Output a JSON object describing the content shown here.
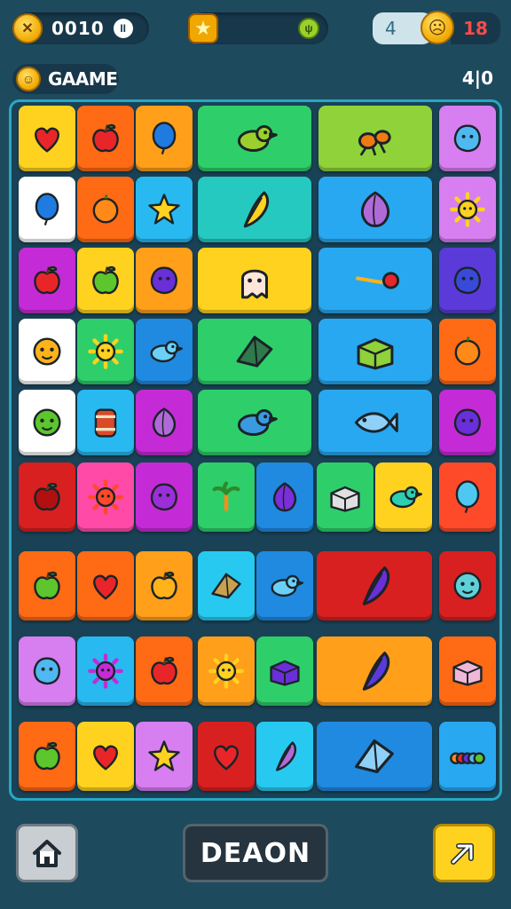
{
  "header": {
    "coin_glyph": "✕",
    "score": "0010",
    "pause_glyph": "II",
    "star_glyph": "★",
    "small_face_glyph": "ψ",
    "lives": "4",
    "face_glyph": "☹",
    "red_count": "18"
  },
  "title_row": {
    "smiley_glyph": "☺",
    "title": "GAAME",
    "moves": "4|0"
  },
  "board": {
    "border_color": "#27a8c4",
    "tiles": [
      {
        "name": "tile-heart",
        "icon": "heart",
        "color": "#ffd21f",
        "icon_color": "#e8262a"
      },
      {
        "name": "tile-apple",
        "icon": "apple",
        "color": "#ff6a14",
        "icon_color": "#e8262a"
      },
      {
        "name": "tile-balloon",
        "icon": "balloon",
        "color": "#ff9f1a",
        "icon_color": "#1f7be0"
      },
      {
        "name": "tile-bird",
        "icon": "bird",
        "color": "#2ecf6a",
        "icon_color": "#9bd02c"
      },
      {
        "name": "tile-ant",
        "icon": "ant",
        "color": "#8fd23a",
        "icon_color": "#f07a12"
      },
      {
        "name": "tile-blob",
        "icon": "blob",
        "color": "#d77ef0",
        "icon_color": "#4fb8f0"
      },
      {
        "name": "tile-balloon-blue",
        "icon": "balloon",
        "color": "#ffffff",
        "icon_color": "#1f7be0"
      },
      {
        "name": "tile-orange",
        "icon": "orange",
        "color": "#ff6a14",
        "icon_color": "#ff8a1a"
      },
      {
        "name": "tile-star",
        "icon": "star",
        "color": "#28b9f0",
        "icon_color": "#ffd21f"
      },
      {
        "name": "tile-feather",
        "icon": "feather",
        "color": "#25c9c0",
        "icon_color": "#ffd21f"
      },
      {
        "name": "tile-onion",
        "icon": "onion",
        "color": "#28a8f0",
        "icon_color": "#b06ad8"
      },
      {
        "name": "tile-sun",
        "icon": "sun",
        "color": "#d77ef0",
        "icon_color": "#ffd21f"
      },
      {
        "name": "tile-apple-red",
        "icon": "apple",
        "color": "#c42bd6",
        "icon_color": "#e8262a"
      },
      {
        "name": "tile-green-apple",
        "icon": "apple",
        "color": "#ffd21f",
        "icon_color": "#5cc62c"
      },
      {
        "name": "tile-grape",
        "icon": "blob",
        "color": "#ff9f1a",
        "icon_color": "#6a2fd8"
      },
      {
        "name": "tile-glove-ghost",
        "icon": "ghost",
        "color": "#ffd21f",
        "icon_color": "#ffe6d8"
      },
      {
        "name": "tile-arrow",
        "icon": "arrow",
        "color": "#28a8f0",
        "icon_color": "#e8262a"
      },
      {
        "name": "tile-bug",
        "icon": "blob",
        "color": "#5a3ad8",
        "icon_color": "#3a4ad8"
      },
      {
        "name": "tile-face-orange",
        "icon": "face",
        "color": "#ffffff",
        "icon_color": "#ffb21a"
      },
      {
        "name": "tile-sun-green",
        "icon": "sun",
        "color": "#2ecf6a",
        "icon_color": "#ffd21f"
      },
      {
        "name": "tile-bird-blue",
        "icon": "bird",
        "color": "#1f8ae0",
        "icon_color": "#6ad0f8"
      },
      {
        "name": "tile-kites",
        "icon": "kite",
        "color": "#2ecf6a",
        "icon_color": "#2f7a4a"
      },
      {
        "name": "tile-box",
        "icon": "box",
        "color": "#28a8f0",
        "icon_color": "#8fd23a"
      },
      {
        "name": "tile-orange-fruit",
        "icon": "orange",
        "color": "#ff6a14",
        "icon_color": "#ff8a1a"
      },
      {
        "name": "tile-green-blob",
        "icon": "face",
        "color": "#ffffff",
        "icon_color": "#5cc62c"
      },
      {
        "name": "tile-barrel",
        "icon": "barrel",
        "color": "#28b9f0",
        "icon_color": "#d84a2a"
      },
      {
        "name": "tile-onion-purple",
        "icon": "onion",
        "color": "#c42bd6",
        "icon_color": "#b06ad8"
      },
      {
        "name": "tile-birds",
        "icon": "bird",
        "color": "#2ecf6a",
        "icon_color": "#3a9ae0"
      },
      {
        "name": "tile-fish",
        "icon": "fish",
        "color": "#28a8f0",
        "icon_color": "#8fd0f8"
      },
      {
        "name": "tile-purple-blob",
        "icon": "blob",
        "color": "#c42bd6",
        "icon_color": "#6a2fd8"
      },
      {
        "name": "tile-apple-dark",
        "icon": "apple",
        "color": "#d82020",
        "icon_color": "#b01010"
      },
      {
        "name": "tile-sun-red",
        "icon": "sun",
        "color": "#ff4aa8",
        "icon_color": "#ff4a2a"
      },
      {
        "name": "tile-plum",
        "icon": "blob",
        "color": "#c42bd6",
        "icon_color": "#9a2fd8"
      },
      {
        "name": "tile-palm",
        "icon": "palm",
        "color": "#2ecf6a",
        "icon_color": "#2f8a2a"
      },
      {
        "name": "tile-eggplant",
        "icon": "onion",
        "color": "#1f8ae0",
        "icon_color": "#7a2fd8"
      },
      {
        "name": "tile-gift",
        "icon": "box",
        "color": "#2ecf6a",
        "icon_color": "#e0e0e0"
      },
      {
        "name": "tile-bird-green",
        "icon": "bird",
        "color": "#ffd21f",
        "icon_color": "#2ecfb0"
      },
      {
        "name": "tile-balloon-cyan",
        "icon": "balloon",
        "color": "#ff4a2a",
        "icon_color": "#4fc8f0"
      },
      {
        "name": "tile-lime",
        "icon": "apple",
        "color": "#ff6a14",
        "icon_color": "#5cc62c"
      },
      {
        "name": "tile-heart-red",
        "icon": "heart",
        "color": "#ff6a14",
        "icon_color": "#e8262a"
      },
      {
        "name": "tile-mango",
        "icon": "apple",
        "color": "#ff9f1a",
        "icon_color": "#ffb21a"
      },
      {
        "name": "tile-plane",
        "icon": "kite",
        "color": "#28c9f0",
        "icon_color": "#c9a050"
      },
      {
        "name": "tile-bird-lightblue",
        "icon": "bird",
        "color": "#1f8ae0",
        "icon_color": "#6ad0f8"
      },
      {
        "name": "tile-rocket",
        "icon": "feather",
        "color": "#d82020",
        "icon_color": "#6a2fd8"
      },
      {
        "name": "tile-virus",
        "icon": "face",
        "color": "#d82020",
        "icon_color": "#5fd0d8"
      },
      {
        "name": "tile-blob-cyan",
        "icon": "blob",
        "color": "#d77ef0",
        "icon_color": "#4fb8f0"
      },
      {
        "name": "tile-virus-purple",
        "icon": "sun",
        "color": "#28b9f0",
        "icon_color": "#c42bd6"
      },
      {
        "name": "tile-apple-orange",
        "icon": "apple",
        "color": "#ff6a14",
        "icon_color": "#e8262a"
      },
      {
        "name": "tile-sun-yellow",
        "icon": "sun",
        "color": "#ff9f1a",
        "icon_color": "#ffd21f"
      },
      {
        "name": "tile-eraser",
        "icon": "box",
        "color": "#2ecf6a",
        "icon_color": "#6a2fd8"
      },
      {
        "name": "tile-feather-purple",
        "icon": "feather",
        "color": "#ff9f1a",
        "icon_color": "#5a3ad8"
      },
      {
        "name": "tile-soap",
        "icon": "box",
        "color": "#ff6a14",
        "icon_color": "#f0b8d8"
      },
      {
        "name": "tile-pear",
        "icon": "apple",
        "color": "#ff6a14",
        "icon_color": "#5cc62c"
      },
      {
        "name": "tile-heart-yellow",
        "icon": "heart",
        "color": "#ffd21f",
        "icon_color": "#e8262a"
      },
      {
        "name": "tile-star-pink",
        "icon": "star",
        "color": "#d77ef0",
        "icon_color": "#ffd21f"
      },
      {
        "name": "tile-heart-dark",
        "icon": "heart",
        "color": "#d82020",
        "icon_color": "#e8262a"
      },
      {
        "name": "tile-lipstick",
        "icon": "feather",
        "color": "#28c9f0",
        "icon_color": "#b06ad8"
      },
      {
        "name": "tile-tool",
        "icon": "kite",
        "color": "#1f8ae0",
        "icon_color": "#8fd0f8"
      },
      {
        "name": "tile-caterpillar",
        "icon": "caterpillar",
        "color": "#28a8f0",
        "icon_color": "#5cc62c"
      },
      {
        "name": "tile-leaf",
        "icon": "feather",
        "color": "#28b9f0",
        "icon_color": "#ffb21a"
      }
    ]
  },
  "footer": {
    "main_label": "DEAON"
  }
}
